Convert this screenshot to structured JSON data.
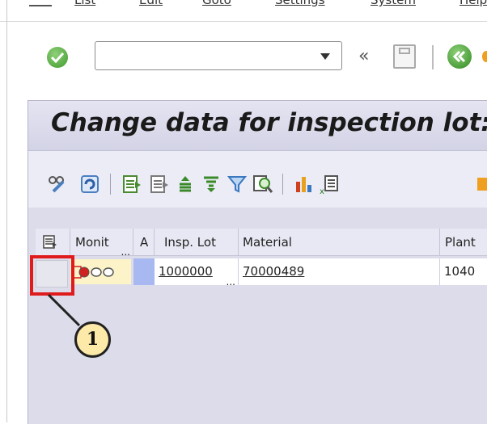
{
  "menubar": {
    "items": [
      "List",
      "Edit",
      "Goto",
      "Settings",
      "System",
      "Help"
    ]
  },
  "toolbar": {
    "command_value": "",
    "chevron": "«"
  },
  "title": "Change data for inspection lot:",
  "table": {
    "headers": [
      "Monit",
      "A",
      "Insp. Lot",
      "Material",
      "Plant"
    ],
    "rows": [
      {
        "monit": "",
        "a": "",
        "insp_lot": "1000000",
        "material": "70000489",
        "plant": "1040"
      }
    ]
  },
  "annotation": {
    "callout_number": "1"
  },
  "colors": {
    "highlight": "#e01b1b",
    "callout_fill": "#fde9a8",
    "panel_bg": "#dcdcea"
  }
}
